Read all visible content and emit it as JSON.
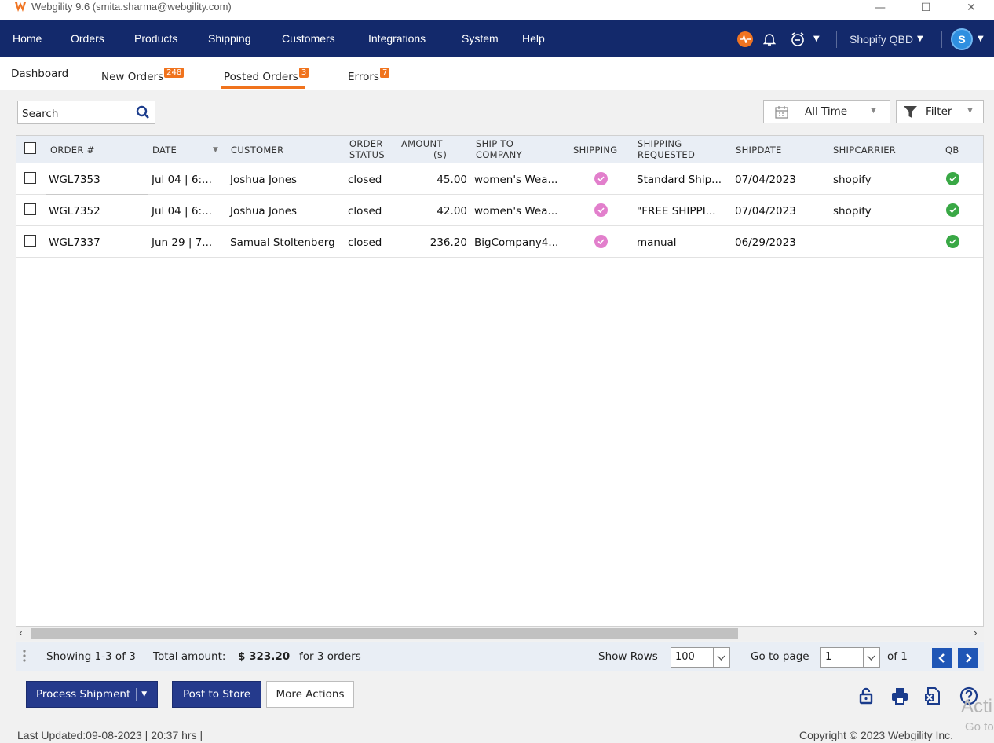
{
  "window": {
    "title": "Webgility 9.6 (smita.sharma@webgility.com)",
    "controls": {
      "minimize": "—",
      "maximize": "☐",
      "close": "✕"
    }
  },
  "nav": {
    "items": [
      "Home",
      "Orders",
      "Products",
      "Shipping",
      "Customers",
      "Integrations",
      "System",
      "Help"
    ],
    "company": "Shopify QBD",
    "avatar_initial": "S",
    "colors": {
      "bar": "#13296b",
      "pulse": "#f07422",
      "avatar": "#2f8fe0"
    }
  },
  "tabs": [
    {
      "label": "Dashboard",
      "badge": ""
    },
    {
      "label": "New Orders",
      "badge": "248"
    },
    {
      "label": "Posted Orders",
      "badge": "3",
      "active": true
    },
    {
      "label": "Errors",
      "badge": "7"
    }
  ],
  "toolbar": {
    "search_placeholder": "Search",
    "date_range": "All Time",
    "filter_label": "Filter"
  },
  "table": {
    "columns": {
      "order": "ORDER #",
      "date": "DATE",
      "customer": "CUSTOMER",
      "status_l1": "ORDER",
      "status_l2": "STATUS",
      "amount_l1": "AMOUNT",
      "amount_l2": "($)",
      "ship_l1": "SHIP TO",
      "ship_l2": "COMPANY",
      "shipping": "SHIPPING",
      "req_l1": "SHIPPING",
      "req_l2": "REQUESTED",
      "shipdate": "SHIPDATE",
      "carrier": "SHIPCARRIER",
      "qb": "QB"
    },
    "rows": [
      {
        "order": "WGL7353",
        "date": "Jul 04 | 6:...",
        "customer": "Joshua Jones",
        "status": "closed",
        "amount": "45.00",
        "company": "women's Wea...",
        "requested": "Standard Ship...",
        "shipdate": "07/04/2023",
        "carrier": "shopify"
      },
      {
        "order": "WGL7352",
        "date": "Jul 04 | 6:...",
        "customer": "Joshua Jones",
        "status": "closed",
        "amount": "42.00",
        "company": "women's Wea...",
        "requested": "\"FREE SHIPPI...",
        "shipdate": "07/04/2023",
        "carrier": "shopify"
      },
      {
        "order": "WGL7337",
        "date": "Jun 29 | 7...",
        "customer": "Samual Stoltenberg",
        "status": "closed",
        "amount": "236.20",
        "company": "BigCompany4...",
        "requested": "manual",
        "shipdate": "06/29/2023",
        "carrier": ""
      }
    ]
  },
  "status": {
    "showing": "Showing 1-3 of 3",
    "total_label": "Total amount:",
    "total_value": "$ 323.20",
    "total_suffix": "for 3 orders",
    "show_rows_label": "Show Rows",
    "show_rows_value": "100",
    "goto_label": "Go to page",
    "page_value": "1",
    "of_label": "of 1"
  },
  "actions": {
    "process_shipment": "Process Shipment",
    "post_to_store": "Post to Store",
    "more_actions": "More Actions"
  },
  "footer": {
    "last_updated": "Last Updated:09-08-2023 | 20:37 hrs |",
    "copyright": "Copyright © 2023 Webgility Inc.",
    "watermark_1": "Acti",
    "watermark_2": "Go to"
  }
}
